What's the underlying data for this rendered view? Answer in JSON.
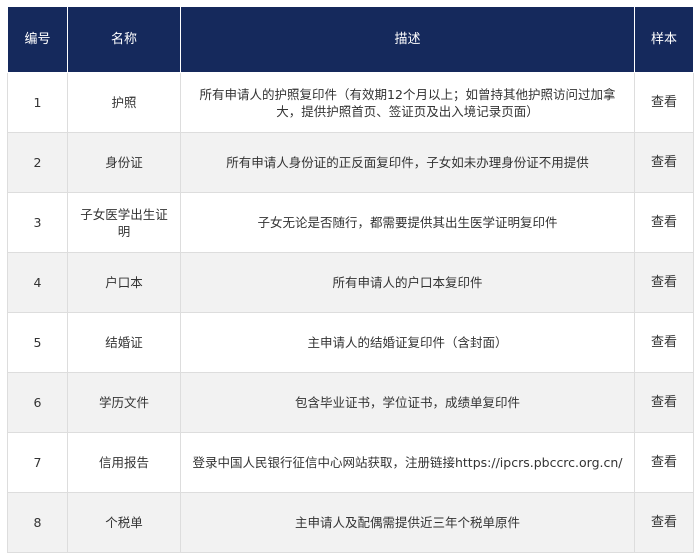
{
  "table": {
    "headers": {
      "no": "编号",
      "name": "名称",
      "desc": "描述",
      "sample": "样本"
    },
    "rows": [
      {
        "no": "1",
        "name": "护照",
        "desc": "所有申请人的护照复印件（有效期12个月以上；如曾持其他护照访问过加拿大，提供护照首页、签证页及出入境记录页面）",
        "sample": "查看"
      },
      {
        "no": "2",
        "name": "身份证",
        "desc": "所有申请人身份证的正反面复印件，子女如未办理身份证不用提供",
        "sample": "查看"
      },
      {
        "no": "3",
        "name": "子女医学出生证明",
        "desc": "子女无论是否随行，都需要提供其出生医学证明复印件",
        "sample": "查看"
      },
      {
        "no": "4",
        "name": "户口本",
        "desc": "所有申请人的户口本复印件",
        "sample": "查看"
      },
      {
        "no": "5",
        "name": "结婚证",
        "desc": "主申请人的结婚证复印件（含封面）",
        "sample": "查看"
      },
      {
        "no": "6",
        "name": "学历文件",
        "desc": "包含毕业证书，学位证书，成绩单复印件",
        "sample": "查看"
      },
      {
        "no": "7",
        "name": "信用报告",
        "desc": "登录中国人民银行征信中心网站获取，注册链接https://ipcrs.pbccrc.org.cn/",
        "sample": "查看"
      },
      {
        "no": "8",
        "name": "个税单",
        "desc": "主申请人及配偶需提供近三年个税单原件",
        "sample": "查看"
      }
    ]
  }
}
